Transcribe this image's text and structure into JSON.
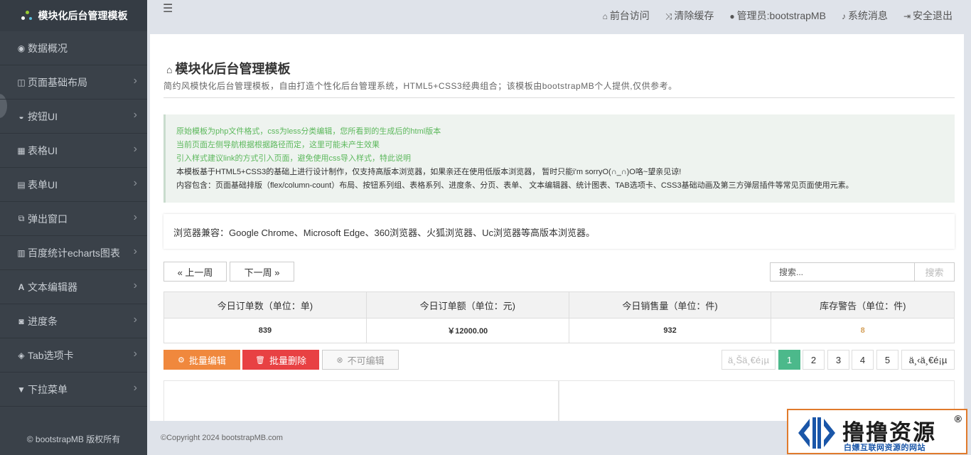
{
  "sidebar": {
    "title": "模块化后台管理模板",
    "items": [
      {
        "label": "数据概况",
        "icon": "dashboard-icon",
        "glyph": "◉",
        "arrow": false
      },
      {
        "label": "页面基础布局",
        "icon": "columns-icon",
        "glyph": "◫",
        "arrow": true
      },
      {
        "label": "按钮UI",
        "icon": "hdd-icon",
        "glyph": "◒",
        "arrow": true
      },
      {
        "label": "表格UI",
        "icon": "table-icon",
        "glyph": "▦",
        "arrow": true
      },
      {
        "label": "表单UI",
        "icon": "list-alt-icon",
        "glyph": "▤",
        "arrow": true
      },
      {
        "label": "弹出窗口",
        "icon": "external-link-icon",
        "glyph": "⧉",
        "arrow": true
      },
      {
        "label": "百度统计echarts图表",
        "icon": "bar-chart-icon",
        "glyph": "▥",
        "arrow": true
      },
      {
        "label": "文本编辑器",
        "icon": "font-icon",
        "glyph": "A",
        "arrow": true
      },
      {
        "label": "进度条",
        "icon": "binoculars-icon",
        "glyph": "◙",
        "arrow": true
      },
      {
        "label": "Tab选项卡",
        "icon": "tags-icon",
        "glyph": "◈",
        "arrow": true
      },
      {
        "label": "下拉菜单",
        "icon": "filter-icon",
        "glyph": "▼",
        "arrow": true
      }
    ],
    "footer": "© bootstrapMB 版权所有"
  },
  "topbar": {
    "links": [
      {
        "label": "前台访问",
        "icon": "home-icon",
        "glyph": "⌂"
      },
      {
        "label": "清除缓存",
        "icon": "random-icon",
        "glyph": "⤨"
      },
      {
        "label": "管理员:bootstrapMB",
        "icon": "user-icon",
        "glyph": "●"
      },
      {
        "label": "系统消息",
        "icon": "bell-icon",
        "glyph": "♪"
      },
      {
        "label": "安全退出",
        "icon": "sign-out-icon",
        "glyph": "⇥"
      }
    ]
  },
  "main": {
    "title": "模块化后台管理模板",
    "description": "简约风模快化后台管理模板，自由打造个性化后台管理系统，HTML5+CSS3经典组合；该模板由bootstrapMB个人提供,仅供参考。",
    "notice": [
      {
        "text": "原始模板为php文件格式，css为less分类编辑，您所看到的生成后的html版本",
        "color": "green"
      },
      {
        "text": "当前页面左侧导航根据根据路径而定，这里可能未产生效果",
        "color": "green"
      },
      {
        "text": "引入样式建议link的方式引入页面，避免使用css导入样式，特此说明",
        "color": "green"
      },
      {
        "text": "本模板基于HTML5+CSS3的基础上进行设计制作，仅支持高版本浏览器，如果亲还在使用低版本浏览器， 暂时只能i'm sorryO(∩_∩)O咯~望亲见谅!",
        "color": "dark"
      },
      {
        "text": "内容包含：页面基础排版（flex/column-count）布局、按钮系列组、表格系列、进度条、分页、表单、 文本编辑器、统计图表、TAB选项卡、CSS3基础动画及第三方弹层插件等常见页面使用元素。",
        "color": "dark"
      }
    ],
    "compat": "浏览器兼容：Google Chrome、Microsoft Edge、360浏览器、火狐浏览器、Uc浏览器等高版本浏览器。",
    "prev_week": "« 上一周",
    "next_week": "下一周 »",
    "search_placeholder": "搜索...",
    "search_button": "搜索",
    "stats_headers": [
      "今日订单数（单位：单)",
      "今日订单额（单位：元)",
      "今日销售量（单位：件)",
      "库存警告（单位：件)"
    ],
    "stats_values": [
      "839",
      "￥12000.00",
      "932",
      "8"
    ],
    "batch_edit": "批量编辑",
    "batch_delete": "批量删除",
    "not_editable": "不可编辑",
    "pagination": {
      "first": "ä¸Šä¸€é¡µ",
      "pages": [
        "1",
        "2",
        "3",
        "4",
        "5"
      ],
      "last": "ä¸‹ä¸€é¡µ",
      "current": "1"
    }
  },
  "footer": {
    "copyright": "©Copyright 2024 bootstrapMB.com"
  },
  "watermark": {
    "title": "撸撸资源",
    "registered": "®",
    "subtitle": "白嫖互联网资源的网站"
  },
  "colors": {
    "sidebar_bg": "#3a4149",
    "accent_green": "#4cb98b",
    "edit_orange": "#f0883d",
    "delete_red": "#e84143",
    "warn_text": "#d4a05a"
  }
}
